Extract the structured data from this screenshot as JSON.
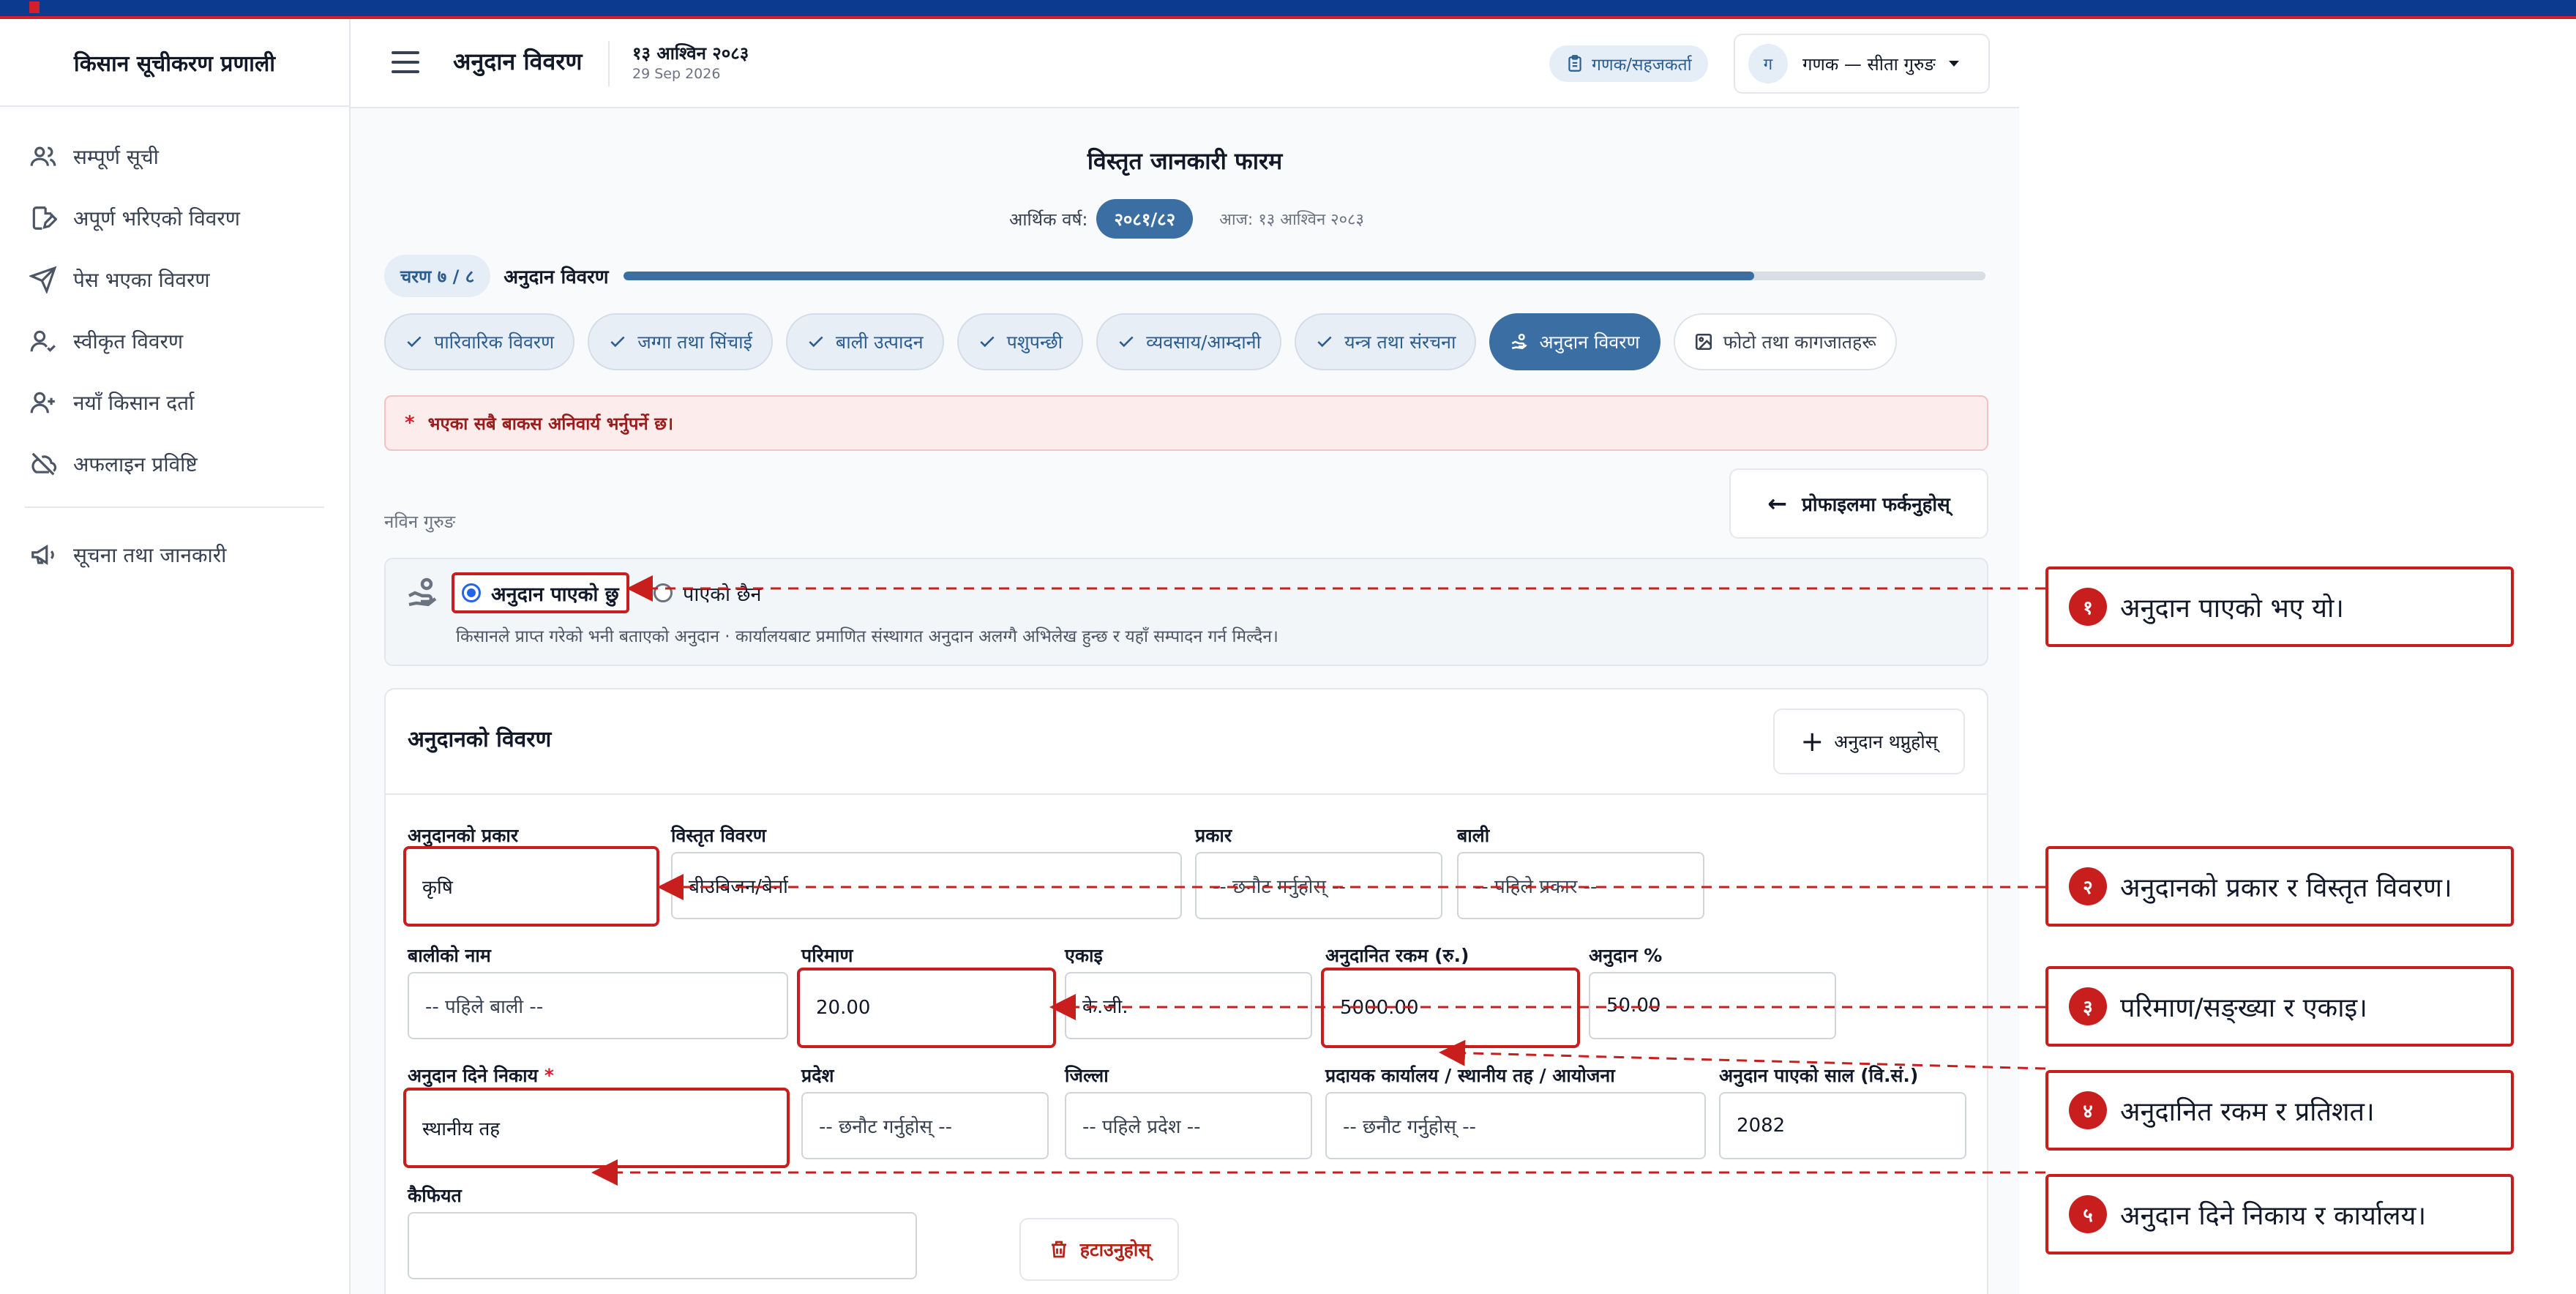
{
  "app": {
    "title": "किसान सूचीकरण प्रणाली"
  },
  "sidebar": {
    "items": [
      {
        "label": "सम्पूर्ण सूची",
        "icon": "users-icon"
      },
      {
        "label": "अपूर्ण भरिएको विवरण",
        "icon": "file-edit-icon"
      },
      {
        "label": "पेस भएका विवरण",
        "icon": "send-icon"
      },
      {
        "label": "स्वीकृत विवरण",
        "icon": "user-check-icon"
      },
      {
        "label": "नयाँ किसान दर्ता",
        "icon": "user-plus-icon"
      },
      {
        "label": "अफलाइन प्रविष्टि",
        "icon": "cloud-off-icon"
      }
    ],
    "secondary": [
      {
        "label": "सूचना तथा जानकारी",
        "icon": "megaphone-icon"
      }
    ]
  },
  "header": {
    "title": "अनुदान विवरण",
    "date_np": "१३ आश्विन २०८३",
    "date_en": "29 Sep 2026",
    "role": "गणक/सहजकर्ता",
    "user_initial": "ग",
    "user_name": "गणक — सीता गुरुङ"
  },
  "form": {
    "title": "विस्तृत जानकारी फारम",
    "fy_label": "आर्थिक वर्ष:",
    "fy_value": "२०८१/८२",
    "today": "आज: १३ आश्विन २०८३",
    "step_label": "चरण ७ / ८",
    "step_name": "अनुदान विवरण",
    "progress": 0.83,
    "tabs": [
      {
        "label": "पारिवारिक विवरण",
        "state": "done"
      },
      {
        "label": "जग्गा तथा सिंचाई",
        "state": "done"
      },
      {
        "label": "बाली उत्पादन",
        "state": "done"
      },
      {
        "label": "पशुपन्छी",
        "state": "done"
      },
      {
        "label": "व्यवसाय/आम्दानी",
        "state": "done"
      },
      {
        "label": "यन्त्र तथा संरचना",
        "state": "done"
      },
      {
        "label": "अनुदान विवरण",
        "state": "active"
      },
      {
        "label": "फोटो तथा कागजातहरू",
        "state": "todo"
      }
    ],
    "alert": "भएका सबै बाकस अनिवार्य भर्नुपर्ने छ।",
    "back_label": "प्रोफाइलमा फर्कनुहोस्",
    "farmer_name": "नविन गुरुङ",
    "grant_received": "अनुदान पाएको छु",
    "grant_not_received": "पाएको छैन",
    "grant_note": "किसानले प्राप्त गरेको भनी बताएको अनुदान · कार्यालयबाट प्रमाणित संस्थागत अनुदान अलग्गै अभिलेख हुन्छ र यहाँ सम्पादन गर्न मिल्दैन।"
  },
  "grant_card": {
    "title": "अनुदानको विवरण",
    "add_label": "अनुदान थप्नुहोस्",
    "fields": {
      "type": {
        "label": "अनुदानको प्रकार",
        "value": "कृषि"
      },
      "detail": {
        "label": "विस्तृत विवरण",
        "value": "बीउबिजन/बेर्ना"
      },
      "kind": {
        "label": "प्रकार",
        "value": "-- छनौट गर्नुहोस् --"
      },
      "crop": {
        "label": "बाली",
        "value": "-- पहिले प्रकार --"
      },
      "crop_name": {
        "label": "बालीको नाम",
        "value": "-- पहिले बाली --"
      },
      "quantity": {
        "label": "परिमाण",
        "value": "20.00"
      },
      "unit": {
        "label": "एकाइ",
        "value": "के.जी."
      },
      "amount": {
        "label": "अनुदानित रकम (रु.)",
        "value": "5000.00"
      },
      "percent": {
        "label": "अनुदान %",
        "value": "50.00"
      },
      "body": {
        "label": "अनुदान दिने निकाय",
        "required": "*",
        "value": "स्थानीय तह"
      },
      "province": {
        "label": "प्रदेश",
        "value": "-- छनौट गर्नुहोस् --"
      },
      "district": {
        "label": "जिल्ला",
        "value": "-- पहिले प्रदेश --"
      },
      "office": {
        "label": "प्रदायक कार्यालय / स्थानीय तह / आयोजना",
        "value": "-- छनौट गर्नुहोस् --"
      },
      "year": {
        "label": "अनुदान पाएको साल (वि.सं.)",
        "value": "2082"
      },
      "remarks": {
        "label": "कैफियत",
        "value": ""
      }
    },
    "delete_label": "हटाउनुहोस्"
  },
  "callouts": [
    {
      "num": "१",
      "text": "अनुदान पाएको भए यो।"
    },
    {
      "num": "२",
      "text": "अनुदानको प्रकार र विस्तृत विवरण।"
    },
    {
      "num": "३",
      "text": "परिमाण/सङ्ख्या र एकाइ।"
    },
    {
      "num": "४",
      "text": "अनुदानित रकम र प्रतिशत।"
    },
    {
      "num": "५",
      "text": "अनुदान दिने निकाय र कार्यालय।"
    }
  ],
  "colors": {
    "accent": "#3b6fa3",
    "annotation": "#c81e1e",
    "topbar": "#0b3a8f"
  }
}
